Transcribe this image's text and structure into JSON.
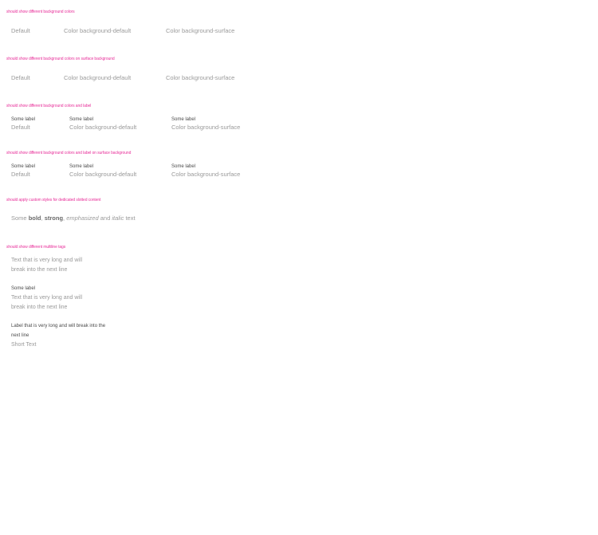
{
  "sections": [
    {
      "title": "should show different background colors",
      "tags": [
        {
          "value": "Default"
        },
        {
          "value": "Color background-default"
        },
        {
          "value": "Color background-surface"
        }
      ]
    },
    {
      "title": "should show different background colors on surface background",
      "tags": [
        {
          "value": "Default"
        },
        {
          "value": "Color background-default"
        },
        {
          "value": "Color background-surface"
        }
      ]
    },
    {
      "title": "should show different background colors and label",
      "tags": [
        {
          "label": "Some label",
          "value": "Default"
        },
        {
          "label": "Some label",
          "value": "Color background-default"
        },
        {
          "label": "Some label",
          "value": "Color background-surface"
        }
      ]
    },
    {
      "title": "should show different background colors and label on surface background",
      "tags": [
        {
          "label": "Some label",
          "value": "Default"
        },
        {
          "label": "Some label",
          "value": "Color background-default"
        },
        {
          "label": "Some label",
          "value": "Color background-surface"
        }
      ]
    },
    {
      "title": "should apply custom styles for dedicated slotted content",
      "rich": {
        "t1": "Some ",
        "bold": "bold",
        "t2": ", ",
        "strong": "strong",
        "t3": ", ",
        "emphasized": "emphasized",
        "t4": " and ",
        "italic": "italic",
        "t5": " text"
      }
    },
    {
      "title": "should show different multiline tags",
      "multi": [
        {
          "value": "Text that is very long and will break into the next line"
        },
        {
          "label": "Some label",
          "value": "Text that is very long and will break into the next line"
        },
        {
          "label": "Label that is very long and will break into the next line",
          "value": "Short Text"
        }
      ]
    }
  ]
}
